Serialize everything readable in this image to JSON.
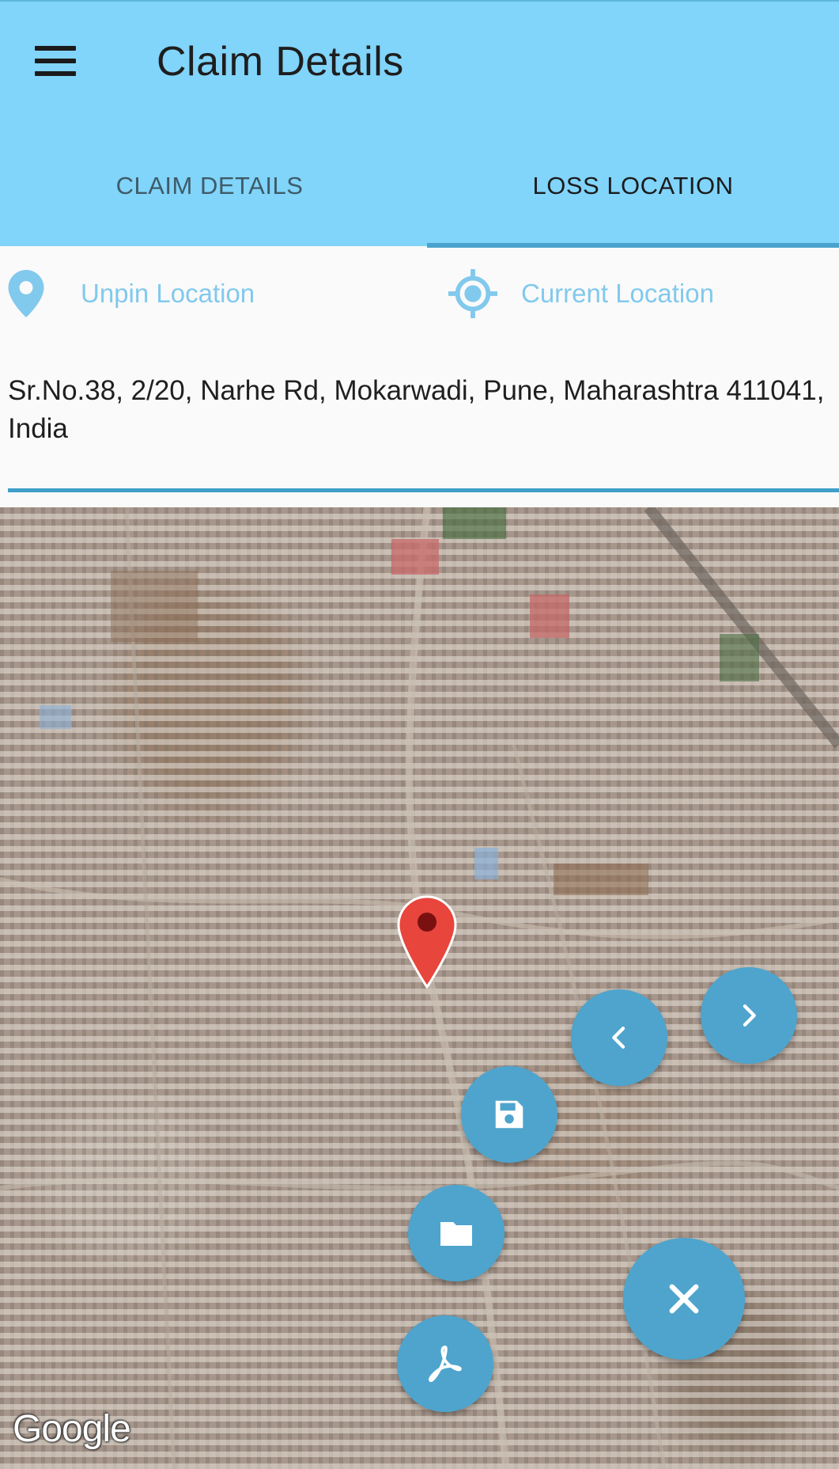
{
  "appbar": {
    "title": "Claim Details",
    "menu_icon": "hamburger-menu-icon",
    "color": "#81d4fa"
  },
  "tabs": [
    {
      "label": "CLAIM DETAILS",
      "selected": false
    },
    {
      "label": "LOSS LOCATION",
      "selected": true
    }
  ],
  "location_actions": {
    "unpin_label": "Unpin Location",
    "unpin_icon": "map-pin-icon",
    "current_label": "Current Location",
    "current_icon": "gps-target-icon",
    "accent": "#81c9ed"
  },
  "address": {
    "value": "Sr.No.38, 2/20, Narhe Rd, Mokarwadi, Pune, Maharashtra 411041, India"
  },
  "map": {
    "type": "satellite",
    "marker_icon": "red-map-marker-icon",
    "attribution": "Google"
  },
  "fab_buttons": {
    "prev_icon": "chevron-left-icon",
    "next_icon": "chevron-right-icon",
    "save_icon": "floppy-disk-icon",
    "folder_icon": "folder-icon",
    "pdf_icon": "pdf-icon",
    "close_icon": "close-icon",
    "color": "#4ea4cd"
  }
}
